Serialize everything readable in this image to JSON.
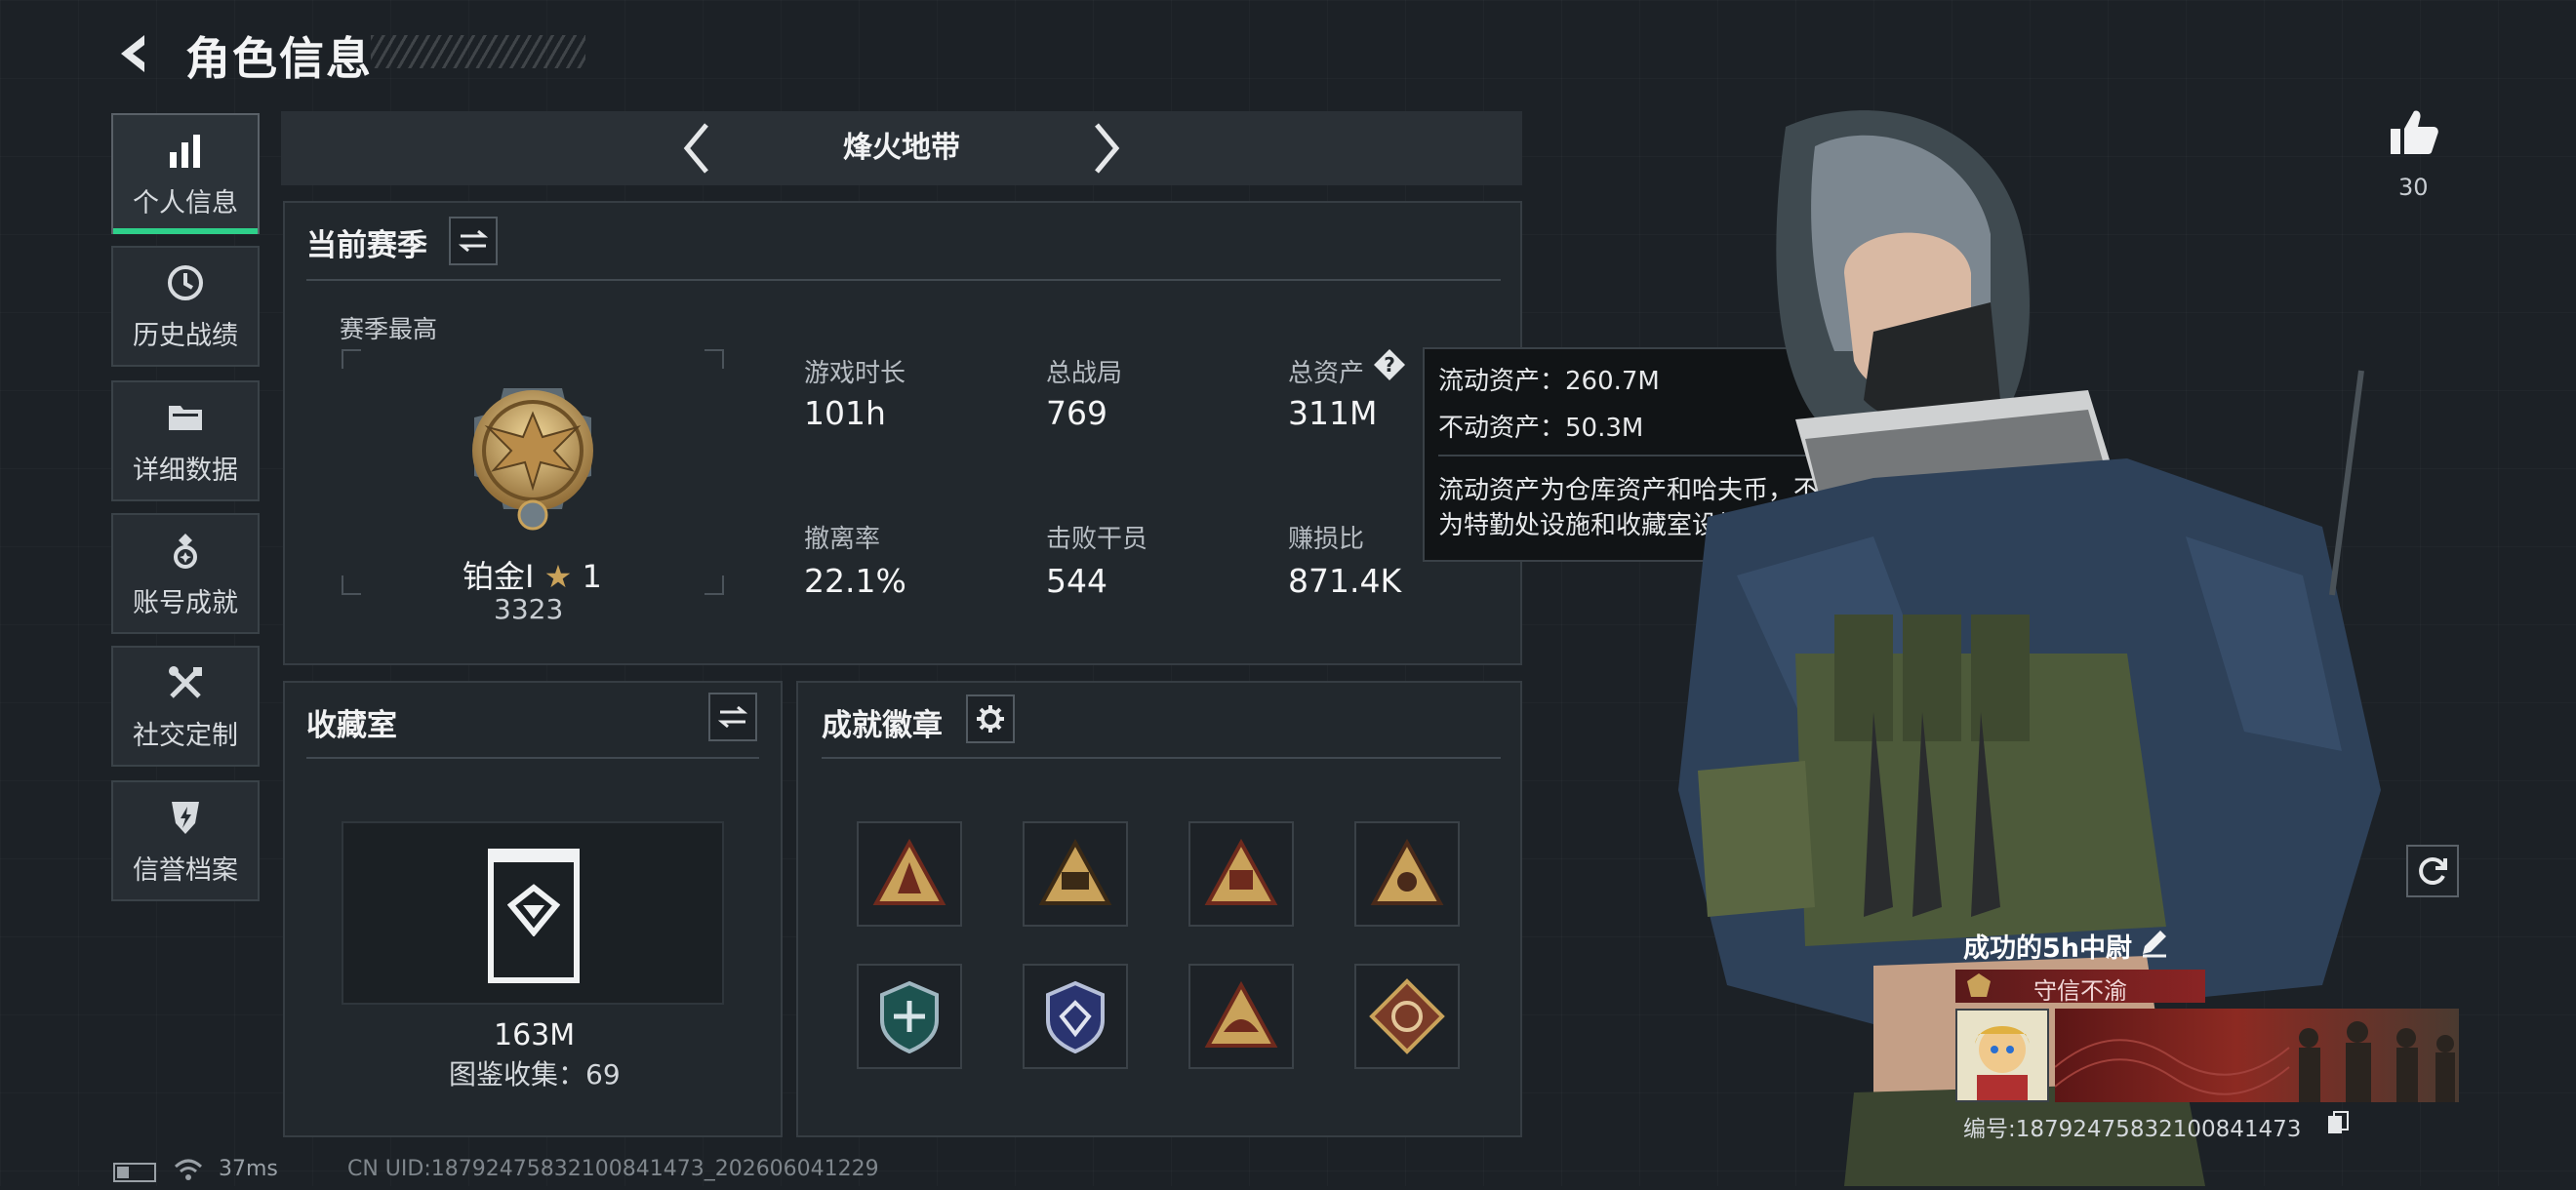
{
  "header": {
    "title": "角色信息"
  },
  "nav": {
    "items": [
      {
        "label": "个人信息",
        "icon": "bar-chart-icon",
        "active": true
      },
      {
        "label": "历史战绩",
        "icon": "history-clock-icon"
      },
      {
        "label": "详细数据",
        "icon": "folder-icon"
      },
      {
        "label": "账号成就",
        "icon": "achievement-icon"
      },
      {
        "label": "社交定制",
        "icon": "tools-icon"
      },
      {
        "label": "信誉档案",
        "icon": "credit-shield-icon"
      }
    ]
  },
  "mode": {
    "title": "烽火地带"
  },
  "season": {
    "title": "当前赛季",
    "best_label": "赛季最高",
    "rank_name": "铂金I",
    "rank_stars": "1",
    "rank_points": "3323",
    "stats": [
      {
        "label": "游戏时长",
        "value": "101h"
      },
      {
        "label": "总战局",
        "value": "769"
      },
      {
        "label": "总资产",
        "value": "311M"
      },
      {
        "label": "撤离率",
        "value": "22.1%"
      },
      {
        "label": "击败干员",
        "value": "544"
      },
      {
        "label": "赚损比",
        "value": "871.4K"
      }
    ]
  },
  "tooltip": {
    "liquid": "流动资产：260.7M",
    "fixed": "不动资产：50.3M",
    "desc1": "流动资产为仓库资产和哈夫币，不动资产",
    "desc2": "为特勤处设施和收藏室设施"
  },
  "collection": {
    "title": "收藏室",
    "value": "163M",
    "catalog": "图鉴收集：69"
  },
  "badges": {
    "title": "成就徽章"
  },
  "profile": {
    "likes": "30",
    "name": "成功的5h中尉",
    "tag": "守信不渝",
    "id_line": "编号:1879247583210084147​3"
  },
  "status": {
    "ping": "37ms",
    "uid": "CN UID:18792475832100841473_202606041229"
  },
  "colors": {
    "accent": "#2ed08a",
    "gold": "#c9a25a",
    "tag_red": "#8a2424"
  }
}
